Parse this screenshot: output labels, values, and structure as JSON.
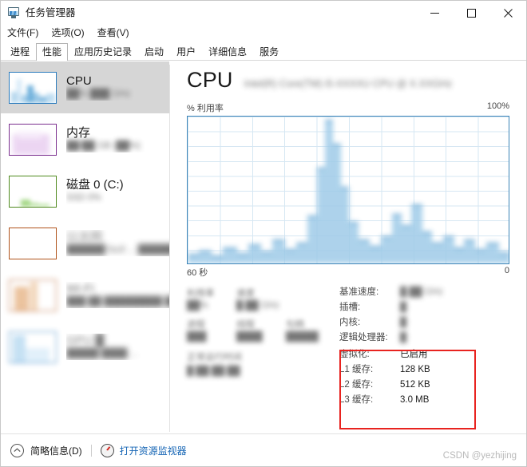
{
  "window": {
    "title": "任务管理器",
    "icon": "task-manager-icon",
    "minimize": "—",
    "maximize": "□",
    "close": "✕"
  },
  "menu": [
    {
      "label": "文件(F)"
    },
    {
      "label": "选项(O)"
    },
    {
      "label": "查看(V)"
    }
  ],
  "tabs": [
    {
      "label": "进程",
      "active": false
    },
    {
      "label": "性能",
      "active": true
    },
    {
      "label": "应用历史记录",
      "active": false
    },
    {
      "label": "启动",
      "active": false
    },
    {
      "label": "用户",
      "active": false
    },
    {
      "label": "详细信息",
      "active": false
    },
    {
      "label": "服务",
      "active": false
    }
  ],
  "sidebar": {
    "items": [
      {
        "name": "cpu",
        "title": "CPU",
        "subtitle_redacted": "██% ███ GHz",
        "border": "#2a7bbd",
        "selected": true,
        "redacted": false
      },
      {
        "name": "memory",
        "title": "内存",
        "subtitle_redacted": "██/██ GB (██%)",
        "border": "#7b2e8e",
        "selected": false,
        "redacted": false
      },
      {
        "name": "disk",
        "title": "磁盘 0 (C:)",
        "subtitle_redacted": "SSD\n0%",
        "border": "#4f8a1e",
        "selected": false,
        "redacted": false
      },
      {
        "name": "ethernet",
        "title_redacted": "以太网",
        "subtitle_redacted": "██████ fault ...\n███████████",
        "border": "#b0521a",
        "selected": false,
        "redacted": true
      },
      {
        "name": "wifi",
        "title_redacted": "Wi-Fi",
        "subtitle_redacted": "███ ██\n█████████ ██us",
        "border": "#b0521a",
        "selected": false,
        "redacted": true
      },
      {
        "name": "gpu",
        "title_redacted": "GPU █",
        "subtitle_redacted": "█████ ████ ...",
        "border": "#2a7bbd",
        "selected": false,
        "redacted": true
      }
    ]
  },
  "main": {
    "heading": "CPU",
    "model_redacted": "Intel(R) Core(TM) i5-XXXXU CPU @ X.XXGHz",
    "axis_label": "% 利用率",
    "axis_max": "100%",
    "time_left": "60 秒",
    "time_right": "0",
    "stats_left": [
      {
        "label_redacted": "利用率",
        "value_redacted": "██%"
      },
      {
        "label_redacted": "速度",
        "value_redacted": "█.██ GHz"
      },
      {
        "label_redacted": "进程",
        "value_redacted": "███"
      },
      {
        "label_redacted": "线程",
        "value_redacted": "████"
      },
      {
        "label_redacted": "句柄",
        "value_redacted": "█████"
      },
      {
        "label_redacted": "正常运行时间",
        "value_redacted": "█:██:██:██"
      }
    ],
    "details": [
      {
        "key": "基准速度:",
        "value_redacted": "█.██ GHz",
        "redacted": true,
        "highlighted": false
      },
      {
        "key": "插槽:",
        "value_redacted": "█",
        "redacted": true,
        "highlighted": false
      },
      {
        "key": "内核:",
        "value_redacted": "█",
        "redacted": true,
        "highlighted": false
      },
      {
        "key": "逻辑处理器:",
        "value_redacted": "█",
        "redacted": true,
        "highlighted": false
      },
      {
        "key": "虚拟化:",
        "value": "已启用",
        "redacted": false,
        "highlighted": true
      },
      {
        "key": "L1 缓存:",
        "value": "128 KB",
        "redacted": false,
        "highlighted": true
      },
      {
        "key": "L2 缓存:",
        "value": "512 KB",
        "redacted": false,
        "highlighted": true
      },
      {
        "key": "L3 缓存:",
        "value": "3.0 MB",
        "redacted": false,
        "highlighted": true
      }
    ],
    "highlight_color": "#e8231f"
  },
  "statusbar": {
    "fewer_details": "简略信息(D)",
    "fewer_icon": "chevron-up-circle-icon",
    "resource_monitor": "打开资源监视器",
    "resource_monitor_icon": "resource-monitor-icon",
    "link_color": "#1464b4"
  },
  "watermark": "CSDN @yezhijing"
}
